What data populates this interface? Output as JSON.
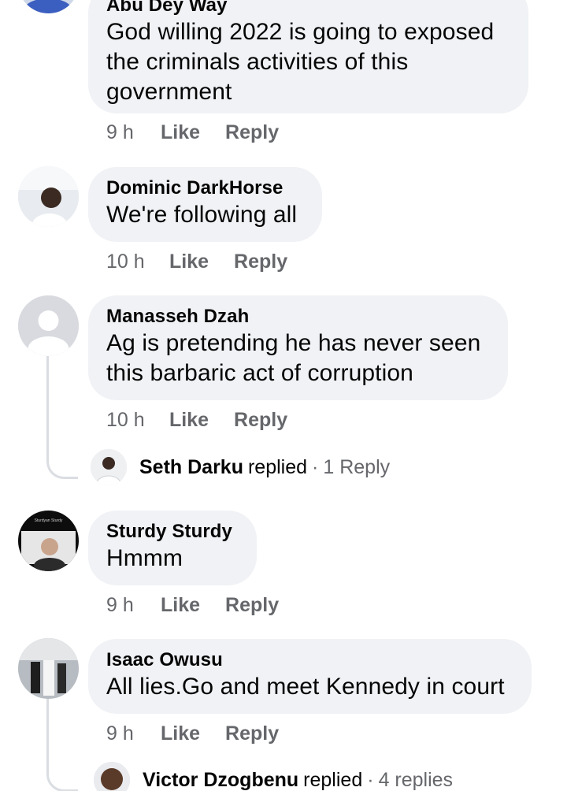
{
  "comments": [
    {
      "author": "Abu Dey Way",
      "text_lines": [
        "God willing 2022 is going to exposed",
        "the criminals activities of this",
        "government"
      ],
      "time": "9 h",
      "like_label": "Like",
      "reply_label": "Reply"
    },
    {
      "author": "Dominic DarkHorse",
      "text_lines": [
        "We're following all"
      ],
      "time": "10 h",
      "like_label": "Like",
      "reply_label": "Reply"
    },
    {
      "author": "Manasseh Dzah",
      "text_lines": [
        "Ag is pretending he has never seen",
        "this barbaric act of corruption"
      ],
      "time": "10 h",
      "like_label": "Like",
      "reply_label": "Reply",
      "replies": {
        "name": "Seth Darku",
        "verb": "replied",
        "separator": "·",
        "count": "1 Reply"
      }
    },
    {
      "author": "Sturdy Sturdy",
      "text_lines": [
        "Hmmm"
      ],
      "time": "9 h",
      "like_label": "Like",
      "reply_label": "Reply",
      "avatar_caption": "Sturdyan Sturdy"
    },
    {
      "author": "Isaac Owusu",
      "text_lines": [
        "All lies.Go and meet Kennedy in court"
      ],
      "time": "9 h",
      "like_label": "Like",
      "reply_label": "Reply",
      "replies": {
        "name": "Victor Dzogbenu",
        "verb": "replied",
        "separator": "·",
        "count": "4 replies"
      }
    }
  ],
  "colors": {
    "bubble": "#f0f2f5",
    "meta_text": "#65676b",
    "primary_text": "#050505",
    "thread_line": "#dadde1"
  }
}
